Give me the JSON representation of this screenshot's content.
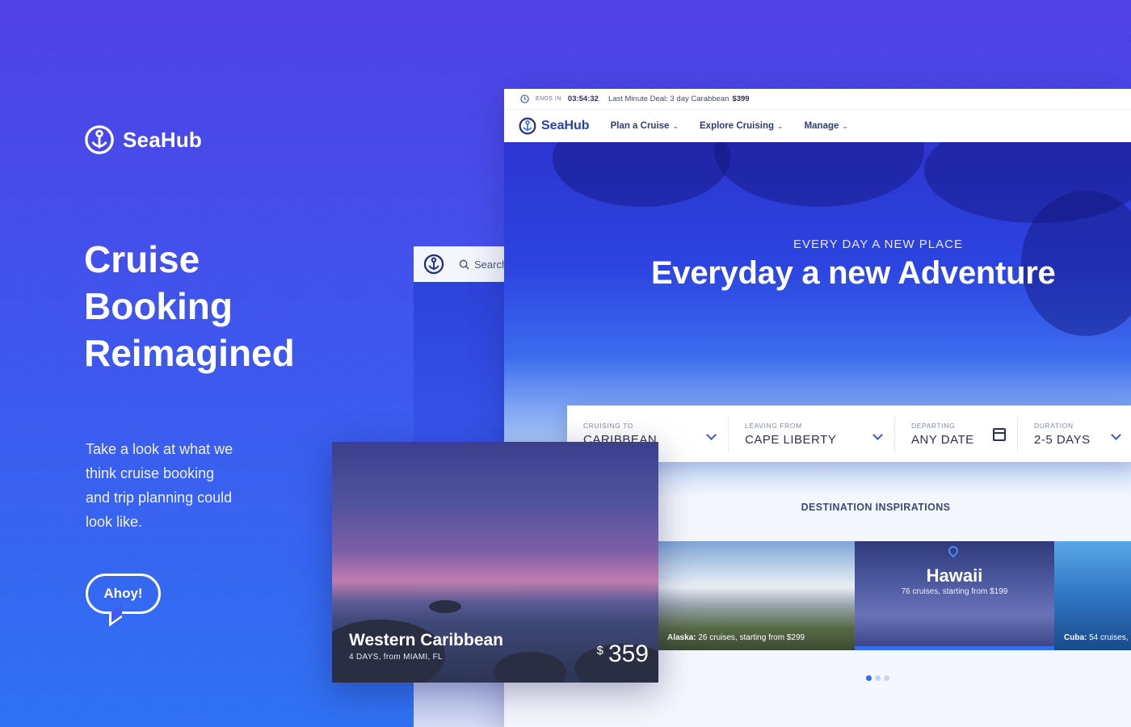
{
  "brand": {
    "name": "SeaHub"
  },
  "headline": {
    "line1": "Cruise",
    "line2": "Booking",
    "line3": "Reimagined"
  },
  "blurb": {
    "line1": "Take a look at what we",
    "line2": "think cruise booking",
    "line3": "and trip planning could",
    "line4": "look like."
  },
  "cta": {
    "label": "Ahoy!"
  },
  "mobile": {
    "search_placeholder": "Search"
  },
  "desktop": {
    "deal": {
      "ends_label": "ENDS IN",
      "timer": "03:54:32",
      "text": "Last Minute Deal: 3 day Carabbean",
      "price": "$399"
    },
    "nav": {
      "logo": "SeaHub",
      "items": [
        {
          "label": "Plan a Cruise"
        },
        {
          "label": "Explore Cruising"
        },
        {
          "label": "Manage"
        }
      ]
    },
    "hero": {
      "subtitle": "EVERY DAY A NEW PLACE",
      "title": "Everyday a new Adventure"
    },
    "search": {
      "cruising_to": {
        "label": "CRUISING TO",
        "value": "CARIBBEAN"
      },
      "leaving_from": {
        "label": "LEAVING FROM",
        "value": "CAPE LIBERTY"
      },
      "departing": {
        "label": "DEPARTING",
        "value": "ANY DATE"
      },
      "duration": {
        "label": "DURATION",
        "value": "2-5 DAYS"
      }
    },
    "inspirations": {
      "heading": "DESTINATION INSPIRATIONS",
      "items": [
        {
          "name": "Alaska:",
          "detail": "26 cruises, starting from $299"
        },
        {
          "name": "Hawaii",
          "detail": "76 cruises, starting from $199"
        },
        {
          "name": "Cuba:",
          "detail": "54 cruises,"
        }
      ],
      "pagination": {
        "active": 1,
        "total": 3
      }
    }
  },
  "featured": {
    "title": "Western Caribbean",
    "subtitle": "4 DAYS, from MIAMI, FL",
    "currency": "$",
    "price": "359"
  },
  "colors": {
    "accent": "#2f6ff0",
    "navy": "#2f3d75",
    "background_top": "#5040e6",
    "background_bottom": "#2f72f2"
  }
}
